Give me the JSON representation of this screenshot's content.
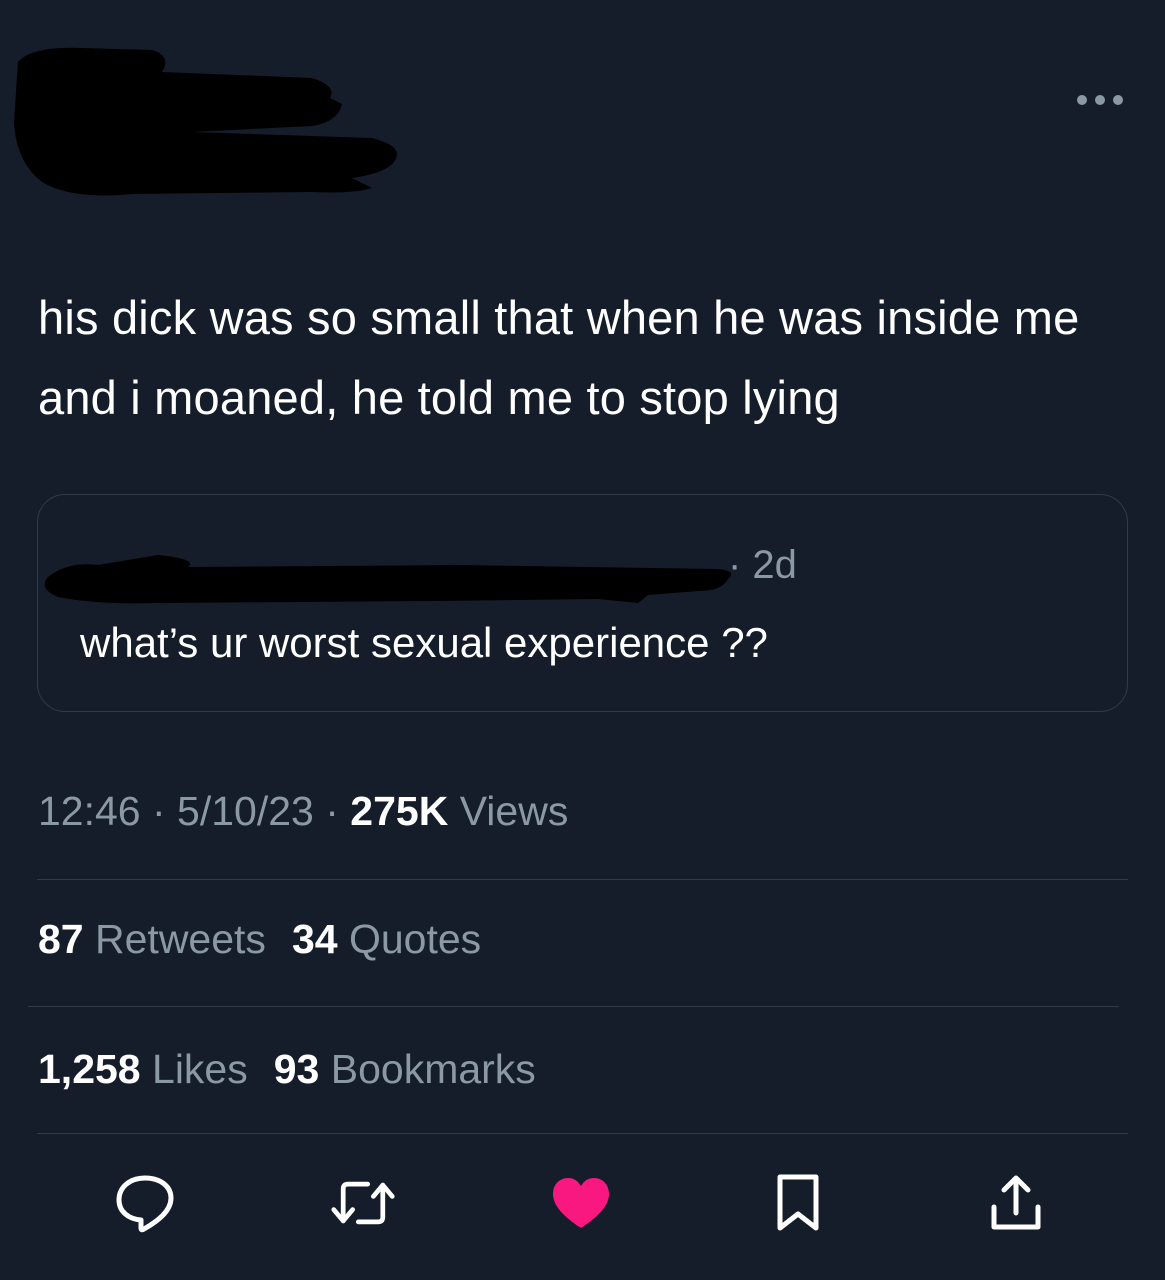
{
  "tweet": {
    "text": "his dick was so small that when he was inside me and i moaned, he told me to stop lying"
  },
  "quoted_tweet": {
    "time": "· 2d",
    "text": "what’s ur worst sexual experience ??"
  },
  "meta": {
    "time": "12:46",
    "sep1": " · ",
    "date": "5/10/23",
    "sep2": " · ",
    "views_count": "275K",
    "views_label": " Views"
  },
  "stats": {
    "retweets_count": "87",
    "retweets_label": "Retweets",
    "quotes_count": "34",
    "quotes_label": "Quotes",
    "likes_count": "1,258",
    "likes_label": "Likes",
    "bookmarks_count": "93",
    "bookmarks_label": "Bookmarks"
  },
  "icons": {
    "more": "more-horizontal-icon",
    "reply": "reply-icon",
    "retweet": "retweet-icon",
    "like": "heart-icon",
    "bookmark": "bookmark-icon",
    "share": "share-icon"
  },
  "colors": {
    "background": "#151d2a",
    "like_active": "#f91880",
    "muted_text": "#8b98a5",
    "border": "#2f3a4a"
  }
}
